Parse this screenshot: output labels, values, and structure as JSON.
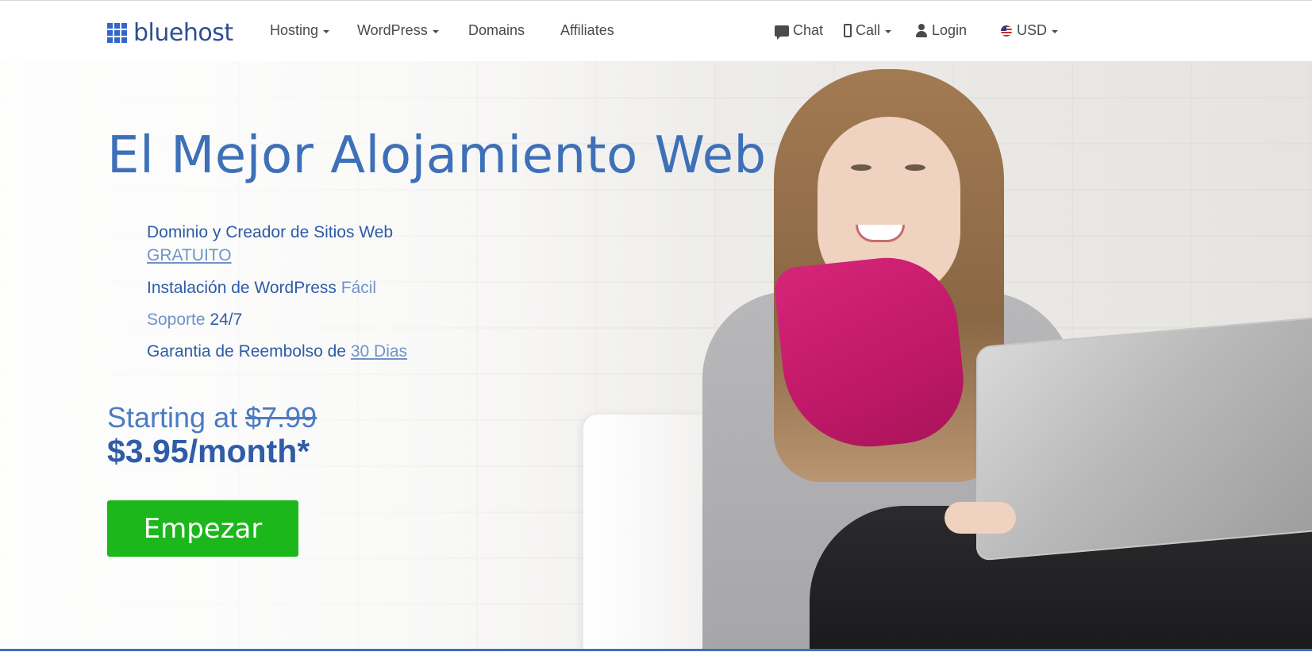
{
  "header": {
    "brand": "bluehost",
    "nav": [
      {
        "label": "Hosting",
        "dropdown": true
      },
      {
        "label": "WordPress",
        "dropdown": true
      },
      {
        "label": "Domains",
        "dropdown": false
      },
      {
        "label": "Affiliates",
        "dropdown": false
      }
    ],
    "utility": {
      "chat": "Chat",
      "call": "Call",
      "login": "Login",
      "currency": "USD"
    }
  },
  "hero": {
    "headline": "El Mejor Alojamiento Web",
    "features": {
      "f1_main": "Dominio y Creador de Sitios Web",
      "f1_link": "GRATUITO",
      "f2_main": "Instalación de WordPress",
      "f2_lite": "Fácil",
      "f3_lite": "Soporte",
      "f3_main": "24/7",
      "f4_main": "Garantia de Reembolso de",
      "f4_link": "30 Dias"
    },
    "starting_label": "Starting at",
    "old_price": "$7.99",
    "price": "$3.95/month*",
    "cta": "Empezar"
  },
  "colors": {
    "brand_blue": "#3d70b8",
    "cta_green": "#1bb71b",
    "scarf_magenta": "#c01868"
  },
  "icons": [
    "chat-icon",
    "phone-icon",
    "user-icon",
    "us-flag-icon",
    "caret-down-icon"
  ]
}
